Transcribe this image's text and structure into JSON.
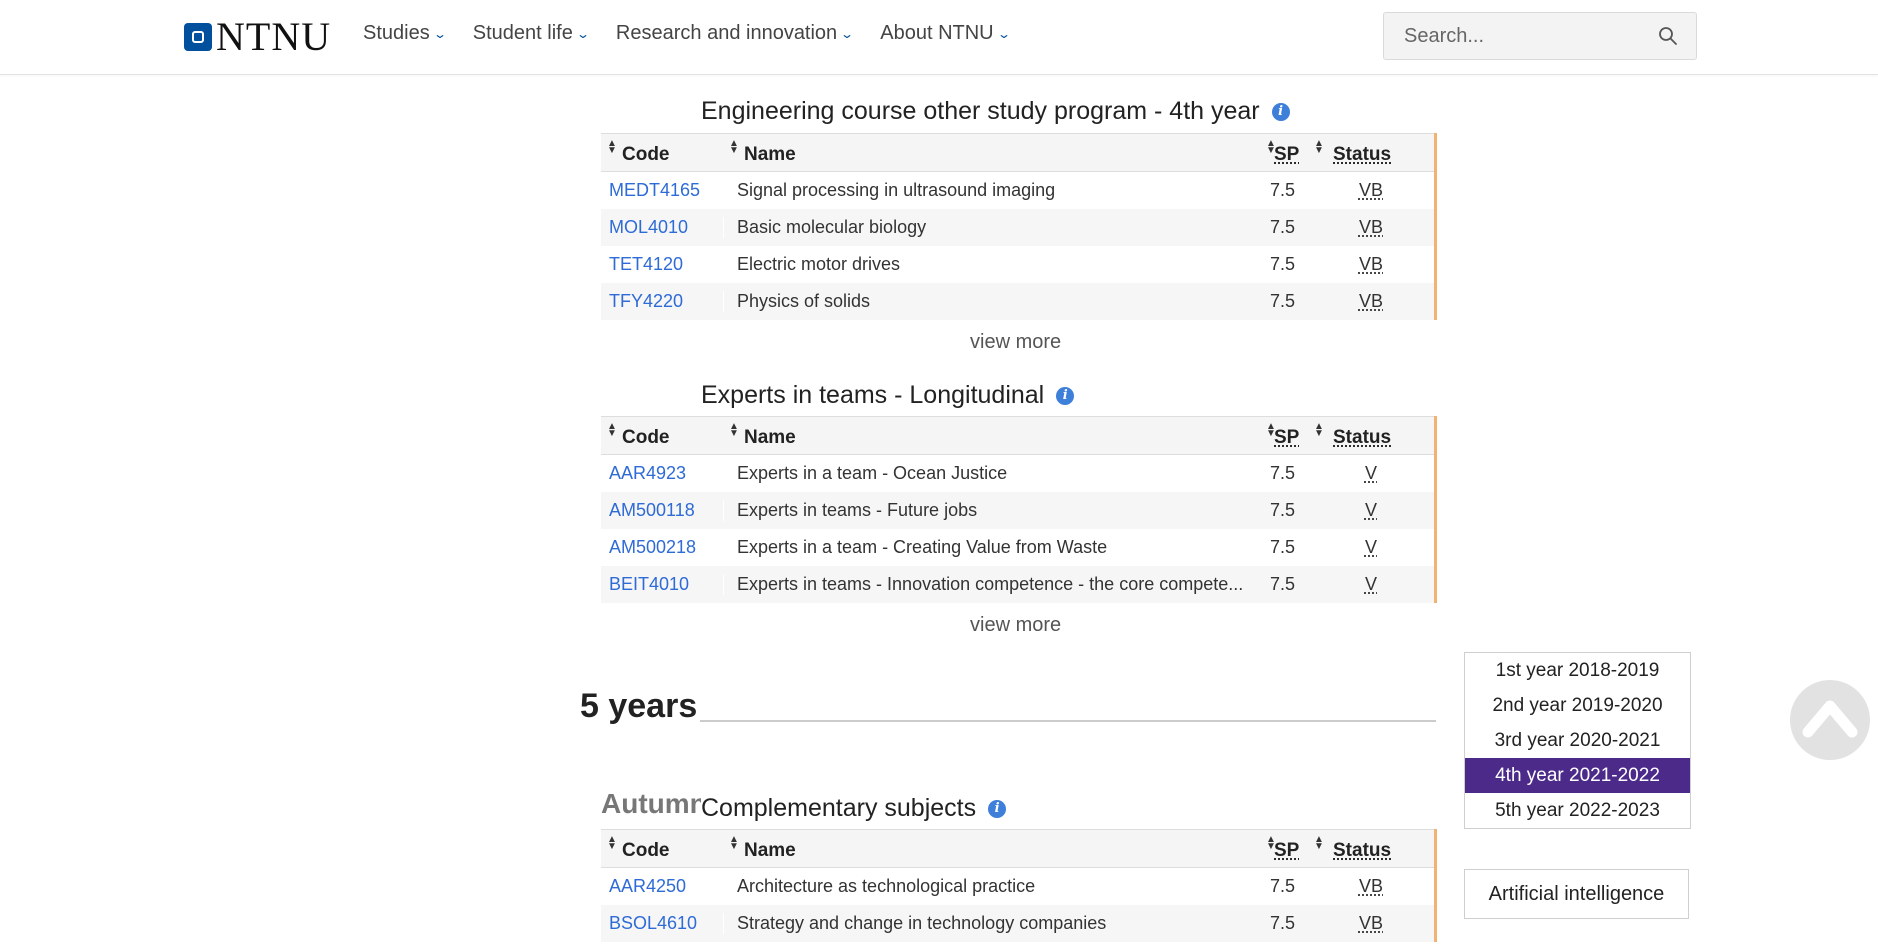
{
  "header": {
    "logo_text": "NTNU",
    "nav": [
      {
        "label": "Studies"
      },
      {
        "label": "Student life"
      },
      {
        "label": "Research and innovation"
      },
      {
        "label": "About NTNU"
      }
    ],
    "search_placeholder": "Search..."
  },
  "table_headers": {
    "code": "Code",
    "name": "Name",
    "sp": "SP",
    "status": "Status"
  },
  "sections": [
    {
      "title": "Engineering course other study program - 4th year",
      "rows": [
        {
          "code": "MEDT4165",
          "name": "Signal processing in ultrasound imaging",
          "sp": "7.5",
          "status": "VB"
        },
        {
          "code": "MOL4010",
          "name": "Basic molecular biology",
          "sp": "7.5",
          "status": "VB"
        },
        {
          "code": "TET4120",
          "name": "Electric motor drives",
          "sp": "7.5",
          "status": "VB"
        },
        {
          "code": "TFY4220",
          "name": "Physics of solids",
          "sp": "7.5",
          "status": "VB"
        }
      ],
      "view_more": "view more"
    },
    {
      "title": "Experts in teams - Longitudinal",
      "rows": [
        {
          "code": "AAR4923",
          "name": "Experts in a team - Ocean Justice",
          "sp": "7.5",
          "status": "V"
        },
        {
          "code": "AM500118",
          "name": "Experts in teams - Future jobs",
          "sp": "7.5",
          "status": "V"
        },
        {
          "code": "AM500218",
          "name": "Experts in a team - Creating Value from Waste",
          "sp": "7.5",
          "status": "V"
        },
        {
          "code": "BEIT4010",
          "name": "Experts in teams - Innovation competence - the core compete...",
          "sp": "7.5",
          "status": "V"
        }
      ],
      "view_more": "view more"
    },
    {
      "title": "Complementary subjects",
      "rows": [
        {
          "code": "AAR4250",
          "name": "Architecture as technological practice",
          "sp": "7.5",
          "status": "VB"
        },
        {
          "code": "BSOL4610",
          "name": "Strategy and change in technology companies",
          "sp": "7.5",
          "status": "VB"
        }
      ]
    }
  ],
  "years_heading": "5 years",
  "autumn_label": "Autumn",
  "year_menu": [
    {
      "label": "1st year 2018-2019",
      "active": false
    },
    {
      "label": "2nd year 2019-2020",
      "active": false
    },
    {
      "label": "3rd year 2020-2021",
      "active": false
    },
    {
      "label": "4th year 2021-2022",
      "active": true
    },
    {
      "label": "5th year 2022-2023",
      "active": false
    }
  ],
  "specialization": "Artificial intelligence",
  "colors": {
    "brand": "#00509e",
    "link": "#2e6bd6",
    "active_year": "#4b2a8a",
    "table_accent": "#f1b274"
  }
}
